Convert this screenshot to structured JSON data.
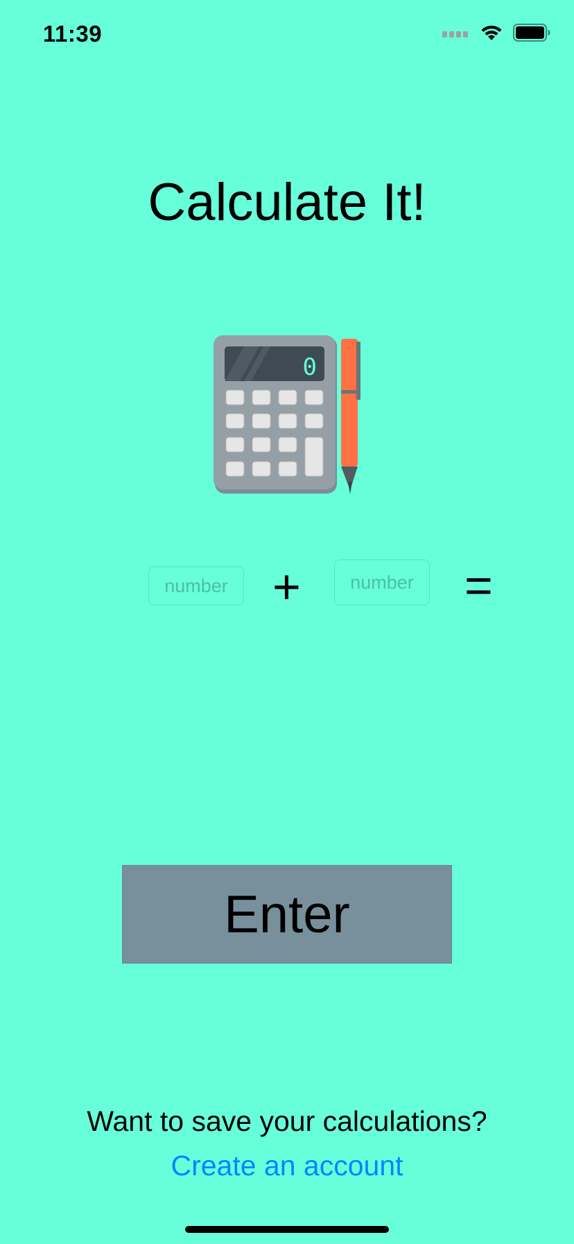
{
  "status_bar": {
    "time": "11:39",
    "icons": [
      "cellular-signal-icon",
      "wifi-icon",
      "battery-icon"
    ]
  },
  "title": "Calculate It!",
  "calculator": {
    "display_value": "0",
    "image_icon": "calculator-with-pen-icon"
  },
  "inputs": {
    "first_placeholder": "number",
    "second_placeholder": "number",
    "first_value": "",
    "second_value": ""
  },
  "operators": {
    "plus": "+",
    "equals": "="
  },
  "enter_button_label": "Enter",
  "save_prompt": "Want to save your calculations?",
  "create_account_link": "Create an account",
  "colors": {
    "background": "#66FFDA",
    "button": "#78909C",
    "link": "#0A84FF"
  }
}
